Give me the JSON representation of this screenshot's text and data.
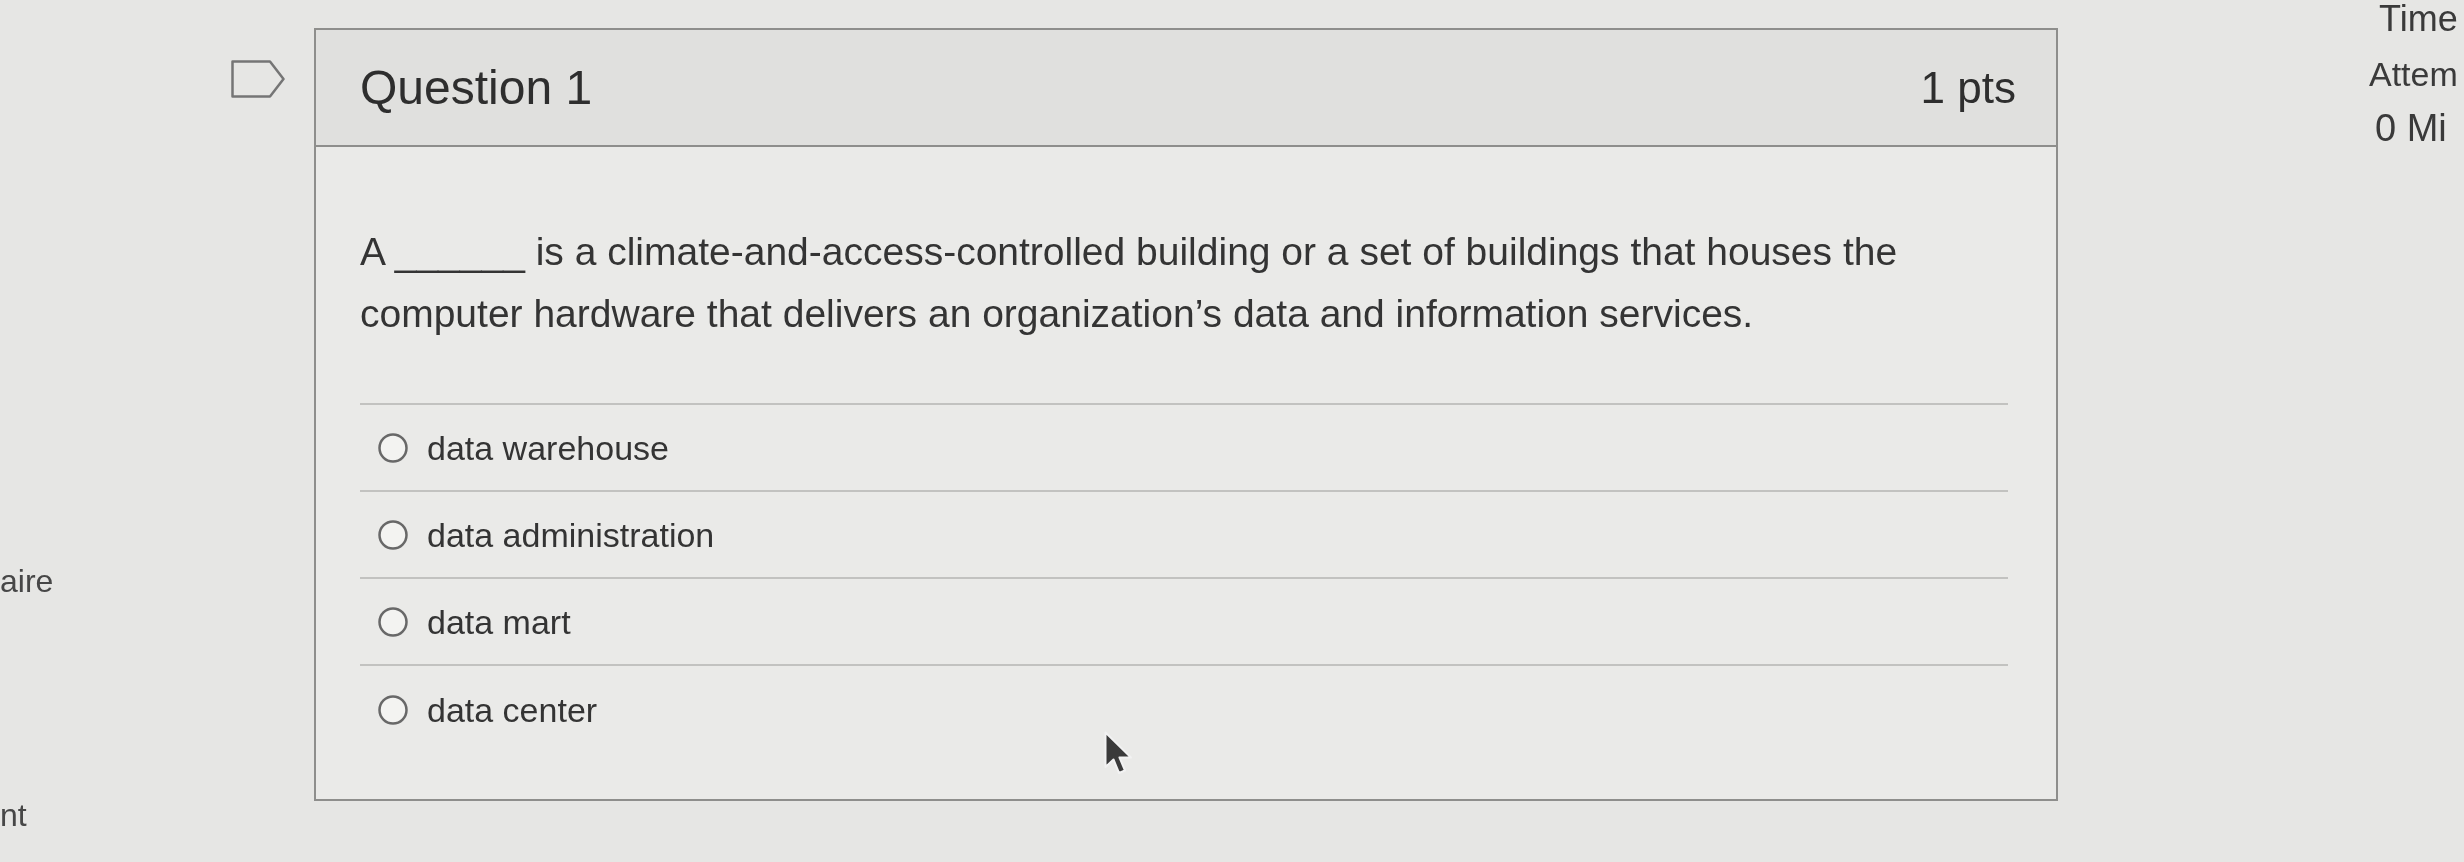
{
  "left_panel": {
    "lines": [
      "aire",
      "nt"
    ]
  },
  "question": {
    "flagged": false,
    "title": "Question 1",
    "points": "1 pts",
    "text": "A ______ is a climate-and-access-controlled building or a set of buildings that houses the computer hardware that delivers an organization’s data and information services.",
    "options": [
      {
        "label": "data warehouse",
        "selected": false
      },
      {
        "label": "data administration",
        "selected": false
      },
      {
        "label": "data mart",
        "selected": false
      },
      {
        "label": "data center",
        "selected": false
      }
    ]
  },
  "right_panel": {
    "title": "Time",
    "lines": [
      {
        "kind": "label",
        "text": "Attem"
      },
      {
        "kind": "value",
        "text": "0 Mi"
      }
    ]
  }
}
